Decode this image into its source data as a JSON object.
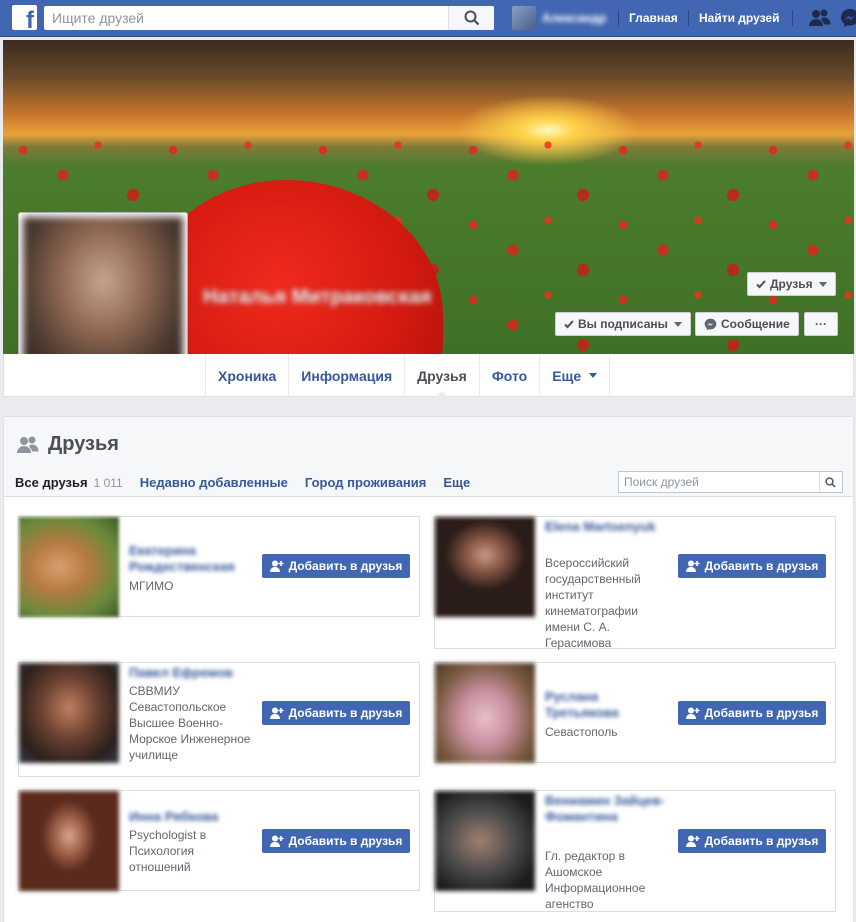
{
  "topbar": {
    "search_placeholder": "Ищите друзей",
    "user_name": "Александр",
    "home": "Главная",
    "find_friends": "Найти друзей"
  },
  "cover": {
    "profile_name": "Наталья Митраковская",
    "friends_btn": "Друзья",
    "following_btn": "Вы подписаны",
    "message_btn": "Сообщение",
    "more_btn": "···"
  },
  "timeline_tabs": [
    "Хроника",
    "Информация",
    "Друзья",
    "Фото",
    "Еще"
  ],
  "friends": {
    "title": "Друзья",
    "subtabs": [
      "Все друзья",
      "Недавно добавленные",
      "Город проживания",
      "Еще"
    ],
    "count": "1 011",
    "search_placeholder": "Поиск друзей",
    "add_label": "Добавить в друзья",
    "items": [
      {
        "name": "Екатерина Рождественская",
        "info": "МГИМО",
        "color": "#c9a35a"
      },
      {
        "name": "Elena Martsenyuk",
        "info": "Всероссийский государственный институт кинематографии имени С. А. Герасимова",
        "color": "#e8b84a"
      },
      {
        "name": "Павел Ефремов",
        "info": "СВВМИУ Севастопольское Высшее Военно-Морское Инженерное училище",
        "color": "#5a4a3c"
      },
      {
        "name": "Руслана Третьякова",
        "info": "Севастополь",
        "color": "#d8a8b8"
      },
      {
        "name": "Инна Рябкова",
        "info": "Psychologist в Психология отношений",
        "color": "#a0624a"
      },
      {
        "name": "Вениамин Зайцев-Фомантина",
        "info": "Гл. редактор в Ашомское Информационное агенство",
        "color": "#4a4a4a"
      }
    ]
  }
}
